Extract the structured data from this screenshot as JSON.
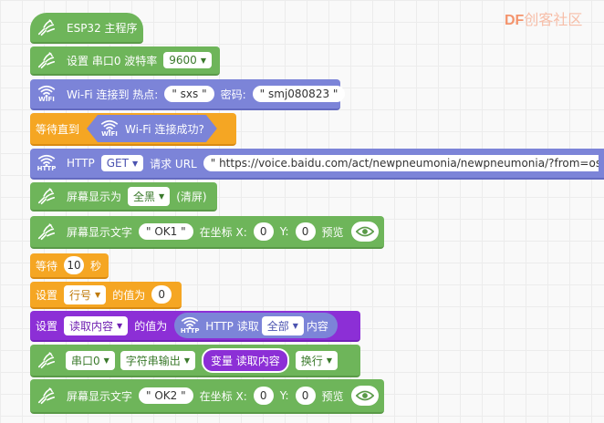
{
  "watermark": {
    "brand": "DF",
    "site": "创客社区"
  },
  "blocks": {
    "main_program": {
      "label": "ESP32 主程序"
    },
    "serial_baud": {
      "label": "设置 串口0 波特率",
      "baud": "9600"
    },
    "wifi_connect": {
      "label": "Wi-Fi 连接到 热点:",
      "ssid": "sxs",
      "pwd_label": "密码:",
      "pwd": "smj080823"
    },
    "wait_until": {
      "label": "等待直到",
      "cond": "Wi-Fi 连接成功?"
    },
    "http_request": {
      "label": "HTTP",
      "method": "GET",
      "url_label": "请求 URL",
      "url": "https://voice.baidu.com/act/newpneumonia/newpneumonia/?from=osari_"
    },
    "screen_fill": {
      "label": "屏幕显示为",
      "mode": "全黑",
      "suffix": "(清屏)"
    },
    "screen_text1": {
      "label": "屏幕显示文字",
      "text": "OK1",
      "at": "在坐标 X:",
      "x": "0",
      "y_label": "Y:",
      "y": "0",
      "preview": "预览"
    },
    "wait_sec": {
      "label": "等待",
      "seconds": "10",
      "unit": "秒"
    },
    "set_row": {
      "label": "设置",
      "var": "行号",
      "value_label": "的值为",
      "value": "0"
    },
    "set_read": {
      "label": "设置",
      "var": "读取内容",
      "value_label": "的值为",
      "http_label": "HTTP 读取",
      "scope": "全部",
      "suffix": "内容"
    },
    "serial_out": {
      "port": "串口0",
      "mode": "字符串输出",
      "var_label": "变量 读取内容",
      "newline": "换行"
    },
    "screen_text2": {
      "label": "屏幕显示文字",
      "text": "OK2",
      "at": "在坐标 X:",
      "x": "0",
      "y_label": "Y:",
      "y": "0",
      "preview": "预览"
    }
  },
  "icons": {
    "wifi_text": "WIFI",
    "http_text": "HTTP"
  },
  "colors": {
    "green": "#6eb55a",
    "blue": "#7c84d8",
    "orange": "#f5a623",
    "purple": "#8c2fd6"
  }
}
